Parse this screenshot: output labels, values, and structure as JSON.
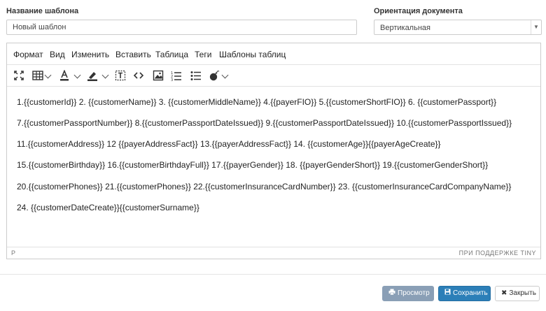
{
  "form": {
    "template_name_label": "Название шаблона",
    "template_name_value": "Новый шаблон",
    "orientation_label": "Ориентация документа",
    "orientation_value": "Вертикальная"
  },
  "editor": {
    "menu": [
      "Формат",
      "Вид",
      "Изменить",
      "Вставить",
      "Таблица",
      "Теги",
      "Шаблоны таблиц"
    ],
    "toolbar_icons": [
      "fullscreen-icon",
      "table-icon",
      "text-color-icon",
      "highlight-color-icon",
      "template-icon",
      "code-icon",
      "image-icon",
      "numbered-list-icon",
      "bullet-list-icon",
      "bomb-icon"
    ],
    "lines": [
      "1.{{customerId}}   2. {{customerName}}  3. {{customerMiddleName}}     4.{{payerFIO}}  5.{{customerShortFIO}}    6. {{customerPassport}}",
      "7.{{customerPassportNumber}}  8.{{customerPassportDateIssued}} 9.{{customerPassportDateIssued}}    10.{{customerPassportIssued}}",
      "11.{{customerAddress}}  12 {{payerAddressFact}}  13.{{payerAddressFact}} 14. {{customerAge}}{{payerAgeCreate}}",
      "15.{{customerBirthday}} 16.{{customerBirthdayFull}} 17.{{payerGender}} 18. {{payerGenderShort}} 19.{{customerGenderShort}}",
      "20.{{customerPhones}} 21.{{customerPhones}} 22.{{customerInsuranceCardNumber}} 23. {{customerInsuranceCardCompanyName}}",
      "24. {{customerDateCreate}}{{customerSurname}}"
    ],
    "status_path": "P",
    "status_brand": "ПРИ ПОДДЕРЖКЕ TINY"
  },
  "buttons": {
    "preview": "Просмотр",
    "save": "Сохранить",
    "close": "Закрыть"
  },
  "colors": {
    "save": "#2c7fb8",
    "preview": "#8a9fb6"
  }
}
